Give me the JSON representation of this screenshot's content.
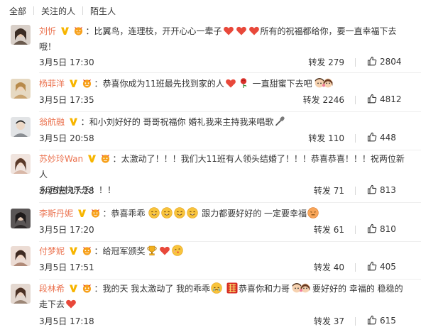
{
  "tabs": {
    "all": "全部",
    "followed": "关注的人",
    "strangers": "陌生人"
  },
  "comments": [
    {
      "name": "刘忻",
      "colon": "：",
      "text_1": "比翼鸟，连理枝，开开心心一辈子",
      "text_2": "所有的祝福都给你，要一直幸福下去",
      "text_3": "哦！",
      "time": "3月5日 17:30",
      "forward": "转发 279",
      "likes": "2804",
      "avatar_color": "#7a6a5e"
    },
    {
      "name": "杨菲洋",
      "colon": "：",
      "text_1": "恭喜你成为11班最先找到家的人",
      "text_2": "一直甜蜜下去吧",
      "time": "3月5日 17:35",
      "forward": "转发 2246",
      "likes": "4812",
      "avatar_color": "#c9a470"
    },
    {
      "name": "翁航融",
      "colon": "：",
      "text_1": "和小刘好好的 哥哥祝福你 婚礼我来主持我来唱歌",
      "time": "3月5日 20:58",
      "forward": "转发 110",
      "likes": "448",
      "avatar_color": "#8a8e93"
    },
    {
      "name": "苏妙玲Wan",
      "colon": "：",
      "text_1": "太激动了！！！我们大11班有人领头结婚了！！！恭喜恭喜！！！祝两位新人",
      "text_2": "永远快快乐乐！！！",
      "time": "3月5日 17:28",
      "forward": "转发 71",
      "likes": "813",
      "avatar_color": "#d9b8a8"
    },
    {
      "name": "李斯丹妮",
      "colon": "：",
      "text_1": "恭喜乖乖",
      "text_2": "跟力都要好好的 一定要幸福",
      "time": "3月5日 17:20",
      "forward": "转发 61",
      "likes": "810",
      "avatar_color": "#4a4848"
    },
    {
      "name": "付梦妮",
      "colon": "：",
      "text_1": "给冠军颁奖",
      "time": "3月5日 17:51",
      "forward": "转发 40",
      "likes": "405",
      "avatar_color": "#b08a78"
    },
    {
      "name": "段林希",
      "colon": "：",
      "text_1": "我的天 我太激动了 我的乖乖",
      "text_2": "恭喜你和力哥",
      "text_3": "要好好的 幸福的 稳稳的",
      "text_4": "走下去",
      "time": "3月5日 17:18",
      "forward": "转发 37",
      "likes": "615",
      "avatar_color": "#9c8676"
    }
  ],
  "colors": {
    "accent": "#eb7350",
    "badge": "#f7b500",
    "heart": "#e8483a",
    "text": "#333333"
  }
}
